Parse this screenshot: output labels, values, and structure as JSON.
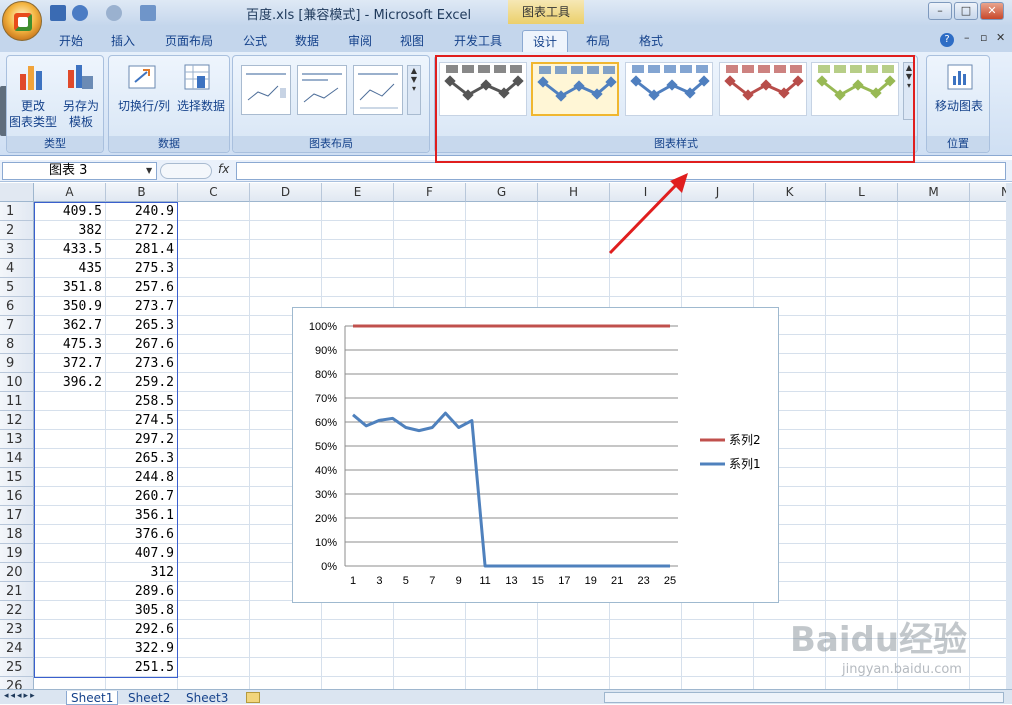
{
  "window": {
    "title": "百度.xls  [兼容模式] - Microsoft Excel",
    "contextual_tools": "图表工具"
  },
  "tabs": [
    "开始",
    "插入",
    "页面布局",
    "公式",
    "数据",
    "审阅",
    "视图",
    "开发工具",
    "设计",
    "布局",
    "格式"
  ],
  "active_tab": "设计",
  "ribbon": {
    "type_group": {
      "label": "类型",
      "change_type": "更改\n图表类型",
      "save_template": "另存为\n模板"
    },
    "data_group": {
      "label": "数据",
      "switch_row_col": "切换行/列",
      "select_data": "选择数据"
    },
    "layout_group": {
      "label": "图表布局"
    },
    "style_group": {
      "label": "图表样式",
      "style_colors": [
        "#555555",
        "#4f7fbf",
        "#4f7fbf",
        "#b84d4a",
        "#98b954"
      ]
    },
    "location_group": {
      "label": "位置",
      "move_chart": "移动图表"
    }
  },
  "formula_bar": {
    "name_box": "图表 3",
    "fx": "fx",
    "content": ""
  },
  "sheet": {
    "columns": [
      "A",
      "B",
      "C",
      "D",
      "E",
      "F",
      "G",
      "H",
      "I",
      "J",
      "K",
      "L",
      "M",
      "N"
    ],
    "rows": [
      "1",
      "2",
      "3",
      "4",
      "5",
      "6",
      "7",
      "8",
      "9",
      "10",
      "11",
      "12",
      "13",
      "14",
      "15",
      "16",
      "17",
      "18",
      "19",
      "20",
      "21",
      "22",
      "23",
      "24",
      "25",
      "26"
    ],
    "col_A": [
      "409.5",
      "382",
      "433.5",
      "435",
      "351.8",
      "350.9",
      "362.7",
      "475.3",
      "372.7",
      "396.2"
    ],
    "col_B": [
      "240.9",
      "272.2",
      "281.4",
      "275.3",
      "257.6",
      "273.7",
      "265.3",
      "267.6",
      "273.6",
      "259.2",
      "258.5",
      "274.5",
      "297.2",
      "265.3",
      "244.8",
      "260.7",
      "356.1",
      "376.6",
      "407.9",
      "312",
      "289.6",
      "305.8",
      "292.6",
      "322.9",
      "251.5"
    ],
    "tabs": [
      "Sheet1",
      "Sheet2",
      "Sheet3"
    ]
  },
  "chart_data": {
    "type": "line",
    "x": [
      1,
      2,
      3,
      4,
      5,
      6,
      7,
      8,
      9,
      10,
      11,
      12,
      13,
      14,
      15,
      16,
      17,
      18,
      19,
      20,
      21,
      22,
      23,
      24,
      25
    ],
    "x_tick_labels": [
      "1",
      "3",
      "5",
      "7",
      "9",
      "11",
      "13",
      "15",
      "17",
      "19",
      "21",
      "23",
      "25"
    ],
    "y_tick_labels": [
      "0%",
      "10%",
      "20%",
      "30%",
      "40%",
      "50%",
      "60%",
      "70%",
      "80%",
      "90%",
      "100%"
    ],
    "ylim": [
      0,
      1
    ],
    "grid": true,
    "legend_position": "right",
    "series": [
      {
        "name": "系列2",
        "color": "#c0504d",
        "values": [
          1,
          1,
          1,
          1,
          1,
          1,
          1,
          1,
          1,
          1,
          1,
          1,
          1,
          1,
          1,
          1,
          1,
          1,
          1,
          1,
          1,
          1,
          1,
          1,
          1
        ]
      },
      {
        "name": "系列1",
        "color": "#4f81bd",
        "values": [
          0.63,
          0.584,
          0.607,
          0.615,
          0.577,
          0.564,
          0.577,
          0.637,
          0.577,
          0.606,
          0,
          0,
          0,
          0,
          0,
          0,
          0,
          0,
          0,
          0,
          0,
          0,
          0,
          0,
          0
        ]
      }
    ]
  },
  "watermark": {
    "brand": "Baidu经验",
    "url": "jingyan.baidu.com"
  }
}
